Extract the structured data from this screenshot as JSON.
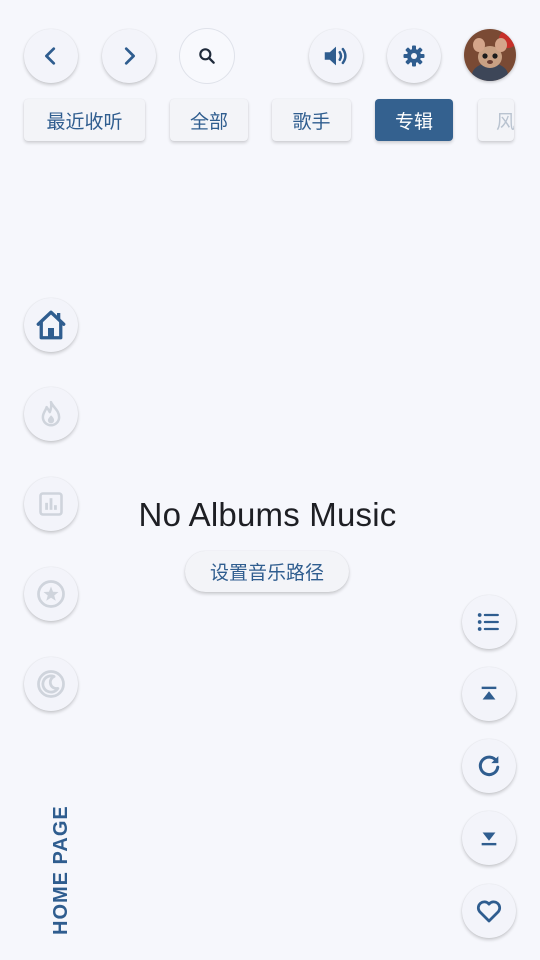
{
  "tabs": [
    {
      "label": "最近收听",
      "active": false
    },
    {
      "label": "全部",
      "active": false
    },
    {
      "label": "歌手",
      "active": false
    },
    {
      "label": "专辑",
      "active": true
    },
    {
      "label": "风",
      "active": false
    }
  ],
  "main": {
    "empty_message": "No Albums Music",
    "set_path_label": "设置音乐路径"
  },
  "sidebar": {
    "vertical_label": "HOME PAGE",
    "items": [
      {
        "icon": "home-icon",
        "active": true
      },
      {
        "icon": "flame-icon",
        "active": false
      },
      {
        "icon": "bar-chart-icon",
        "active": false
      },
      {
        "icon": "star-icon",
        "active": false
      },
      {
        "icon": "moon-icon",
        "active": false
      }
    ]
  },
  "top_bar": {
    "icons": [
      "back-icon",
      "forward-icon",
      "search-icon",
      "volume-icon",
      "settings-icon",
      "avatar"
    ]
  },
  "right_actions": {
    "icons": [
      "list-icon",
      "scroll-top-icon",
      "refresh-icon",
      "scroll-bottom-icon",
      "heart-icon"
    ]
  },
  "colors": {
    "accent": "#34618f",
    "background": "#f6f7fc",
    "icon_inactive": "#cfd4dc"
  }
}
